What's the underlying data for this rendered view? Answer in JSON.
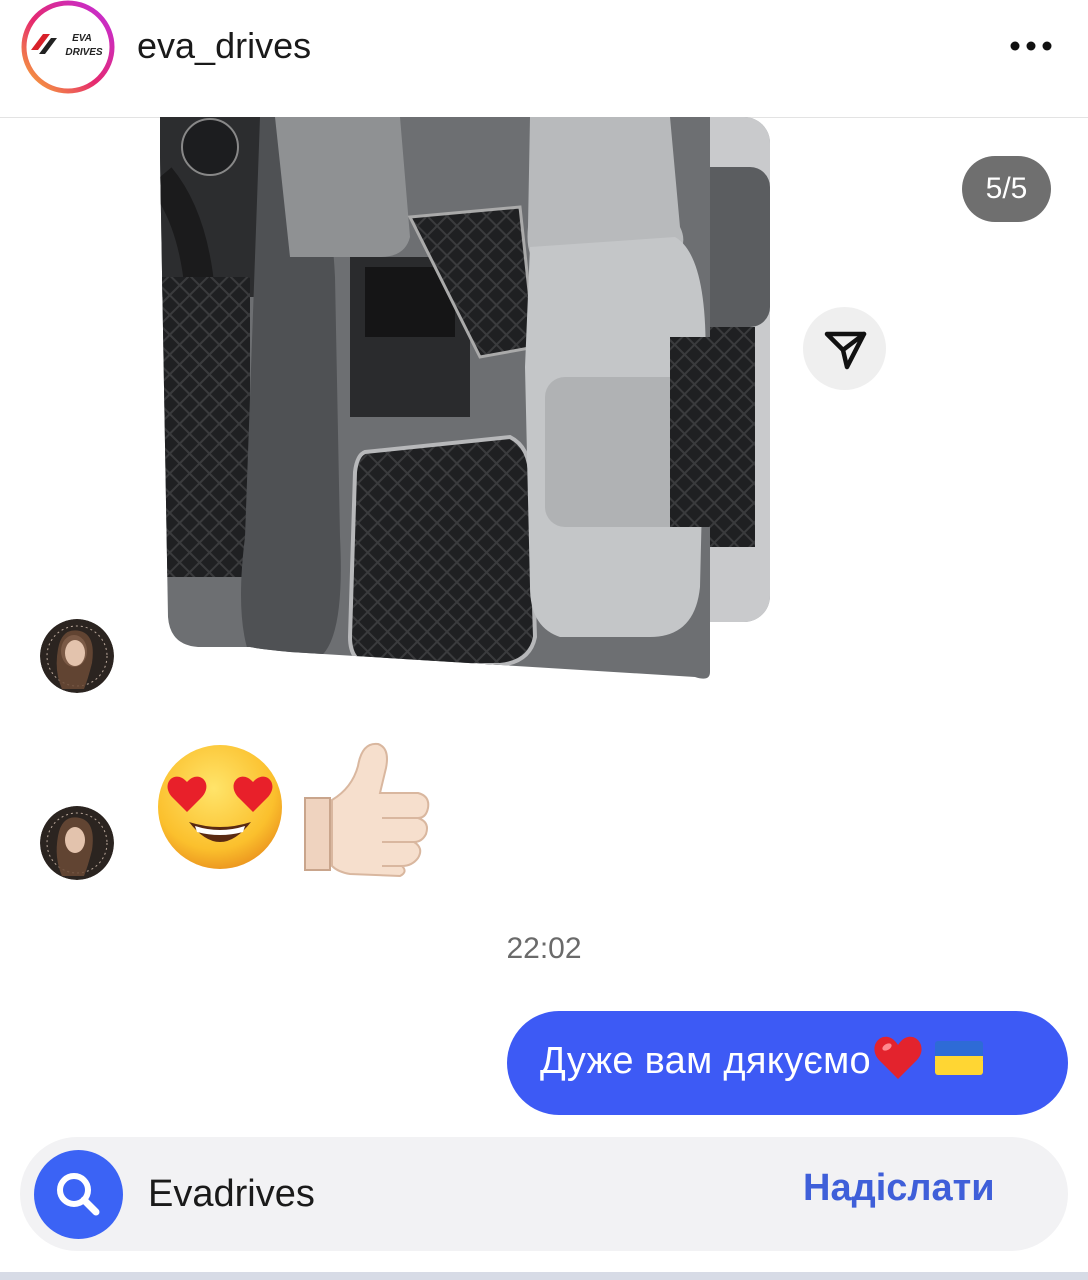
{
  "header": {
    "username": "eva_drives",
    "logo_text_line1": "EVA",
    "logo_text_line2": "DRIVES",
    "more_icon": "more-horizontal-icon"
  },
  "media": {
    "page_indicator": "5/5",
    "share_icon": "send-icon"
  },
  "messages": {
    "emojis": [
      "😍",
      "👍🏻"
    ],
    "timestamp": "22:02",
    "sent_text": "Дуже вам дякуємо",
    "sent_emoji_heart": "❤️",
    "sent_emoji_flag": "🇺🇦"
  },
  "composer": {
    "input_value": "Evadrives",
    "send_label": "Надіслати",
    "search_icon": "search-icon"
  },
  "colors": {
    "accent_blue": "#3d5af5",
    "send_blue": "#3f5fd9",
    "pill_gray": "#6f6f6f"
  }
}
